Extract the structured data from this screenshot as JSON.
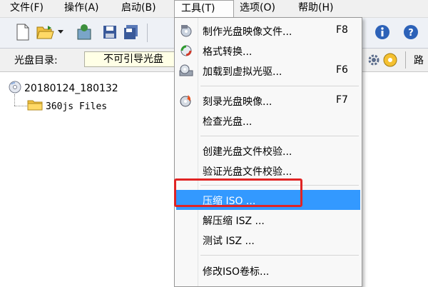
{
  "menubar": {
    "items": [
      "文件(F)",
      "操作(A)",
      "启动(B)",
      "工具(T)",
      "选项(O)",
      "帮助(H)"
    ]
  },
  "address": {
    "label": "光盘目录:",
    "value": "不可引导光盘"
  },
  "toolbar": {
    "right_text": "路"
  },
  "tree": {
    "root": {
      "label": "20180124_180132",
      "icon": "cd-icon"
    },
    "child": {
      "label": "360js Files",
      "icon": "folder-icon"
    }
  },
  "dropdown": {
    "items": [
      {
        "label": "制作光盘映像文件...",
        "shortcut": "F8",
        "icon": "make-image-icon"
      },
      {
        "label": "格式转换...",
        "shortcut": "",
        "icon": "convert-icon"
      },
      {
        "label": "加载到虚拟光驱...",
        "shortcut": "F6",
        "icon": "virtual-drive-icon"
      },
      {
        "label": "刻录光盘映像...",
        "shortcut": "F7",
        "icon": "burn-icon"
      },
      {
        "label": "检查光盘...",
        "shortcut": ""
      },
      {
        "label": "创建光盘文件校验...",
        "shortcut": ""
      },
      {
        "label": "验证光盘文件校验...",
        "shortcut": ""
      },
      {
        "label": "压缩 ISO ...",
        "shortcut": "",
        "highlighted": true
      },
      {
        "label": "解压缩 ISZ ...",
        "shortcut": ""
      },
      {
        "label": "测试 ISZ ...",
        "shortcut": ""
      },
      {
        "label": "修改ISO卷标...",
        "shortcut": ""
      }
    ]
  },
  "colors": {
    "highlight": "#3399ff",
    "annotation": "#e02424",
    "address_field": "#ffffe6"
  }
}
